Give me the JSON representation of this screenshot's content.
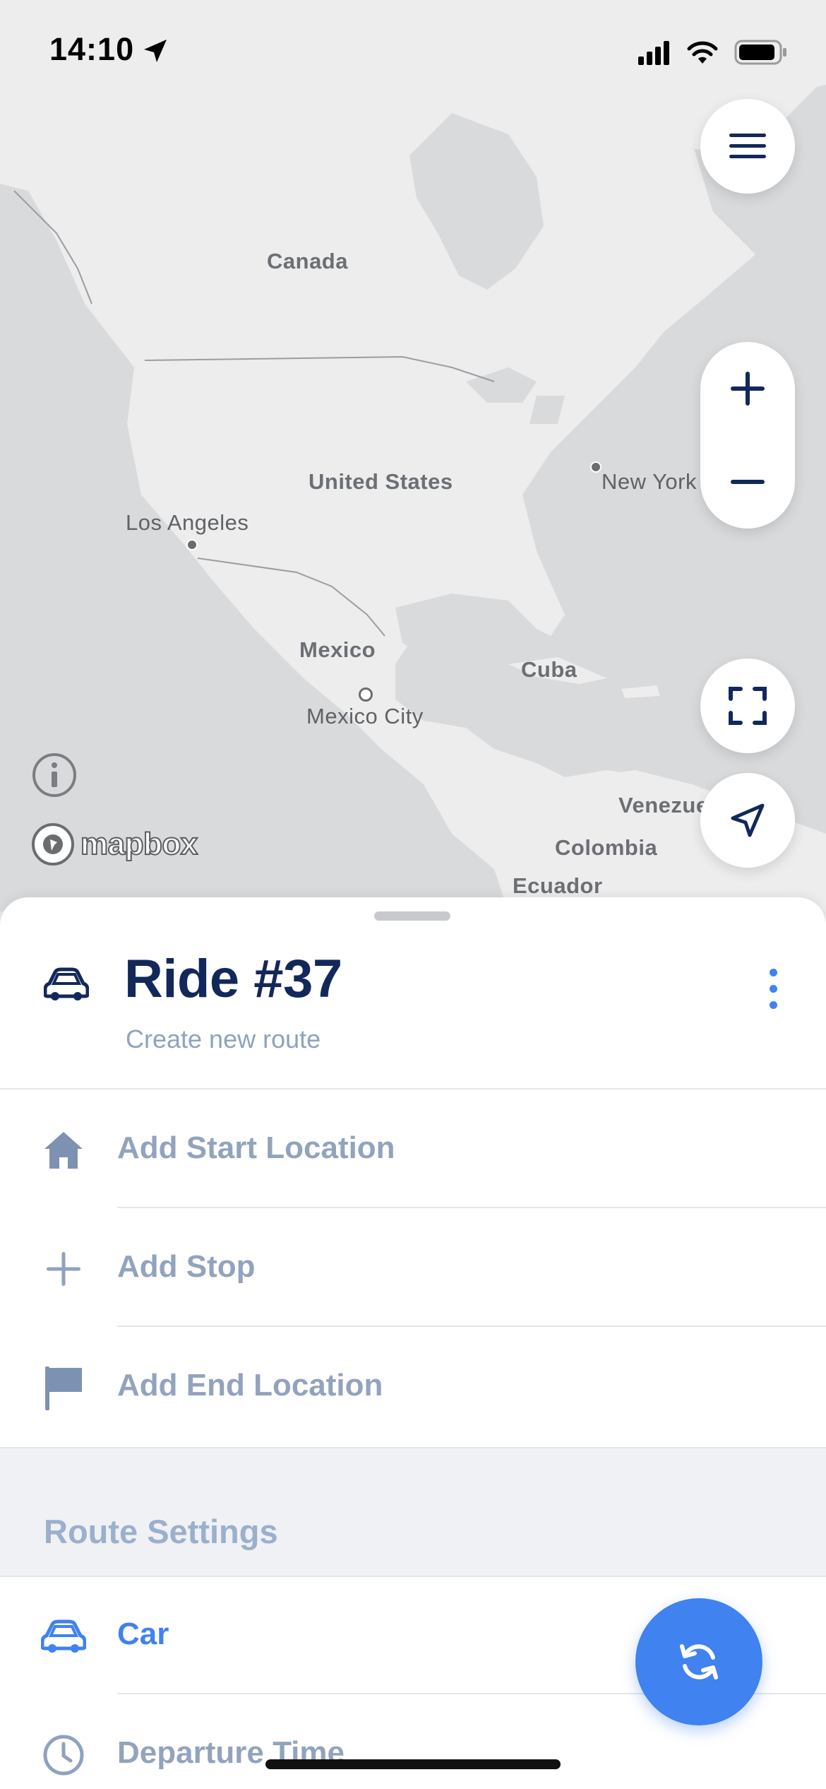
{
  "status_bar": {
    "time": "14:10"
  },
  "map": {
    "labels": {
      "canada": "Canada",
      "united_states": "United States",
      "new_york": "New York",
      "los_angeles": "Los Angeles",
      "mexico": "Mexico",
      "mexico_city": "Mexico City",
      "cuba": "Cuba",
      "venezuela": "Venezue",
      "colombia": "Colombia",
      "ecuador": "Ecuador"
    },
    "attribution": "mapbox",
    "buttons": {
      "menu": "menu-icon",
      "zoom_in": "plus-icon",
      "zoom_out": "minus-icon",
      "fit": "fullscreen-icon",
      "locate": "location-arrow-icon"
    }
  },
  "sheet": {
    "title": "Ride #37",
    "subtitle": "Create new route",
    "route_rows": [
      {
        "label": "Add Start Location",
        "icon": "home-icon"
      },
      {
        "label": "Add Stop",
        "icon": "plus-icon"
      },
      {
        "label": "Add End Location",
        "icon": "flag-icon"
      }
    ],
    "settings_title": "Route Settings",
    "settings_rows": [
      {
        "label": "Car",
        "icon": "car-icon"
      },
      {
        "label": "Departure Time",
        "icon": "clock-icon"
      }
    ],
    "fab_icon": "refresh-icon"
  },
  "colors": {
    "primary_navy": "#13285a",
    "accent_blue": "#3f82f0",
    "muted_label": "#92a3bd"
  }
}
